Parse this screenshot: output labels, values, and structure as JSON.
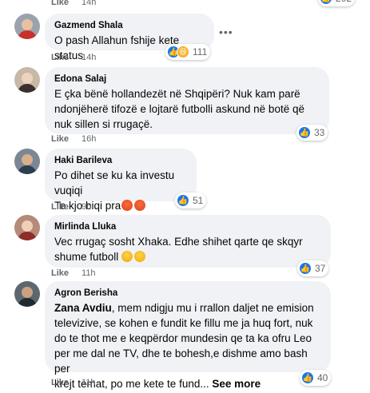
{
  "top": {
    "like_label": "Like",
    "time": "14h",
    "reaction_count": "202"
  },
  "comments": [
    {
      "author": "Gazmend Shala",
      "lines": [
        "O pash Allahun fshije kete status"
      ],
      "reaction_count": "111",
      "like_label": "Like",
      "time": "14h"
    },
    {
      "author": "Edona Salaj",
      "lines": [
        "E çka bënë hollandezët në Shqipëri? Nuk kam parë",
        "ndonjëherë tifozë e lojtarë futbolli askund në botë që",
        "nuk sillen si rrugaçë."
      ],
      "reaction_count": "33",
      "like_label": "Like",
      "time": "16h"
    },
    {
      "author": "Haki Barileva",
      "lines": [
        "Po dihet se ku ka investu vuqiqi",
        "Te kjo biqi pra"
      ],
      "reaction_count": "51",
      "like_label": "Like",
      "time": "9h"
    },
    {
      "author": "Mirlinda Lluka",
      "lines": [
        "Vec rrugaç sosht Xhaka. Edhe shihet qarte qe skqyr",
        "shume futboll"
      ],
      "reaction_count": "37",
      "like_label": "Like",
      "time": "11h"
    },
    {
      "author": "Agron Berisha",
      "mention": "Zana Avdiu",
      "lines": [
        ", mem ndigju mu i rrallon daljet ne emision",
        "televizive, se kohen e fundit ke fillu me ja huq fort, nuk",
        "do te thot me e keqpërdor mundesin qe ta ka ofru Leo",
        "per me dal ne TV, dhe te bohesh,e dishme amo bash per",
        "krejt temat, po me kete te fund..."
      ],
      "see_more": "See more",
      "reaction_count": "40",
      "like_label": "Like",
      "time": "11h"
    }
  ],
  "icons": {
    "like": "like-reaction-icon",
    "haha": "haha-reaction-icon",
    "angry": "angry-reaction-icon",
    "more": "more-options-icon"
  },
  "colors": {
    "bubble": "#f0f2f5",
    "like_blue": "#1877f2",
    "meta_gray": "#65676b"
  }
}
